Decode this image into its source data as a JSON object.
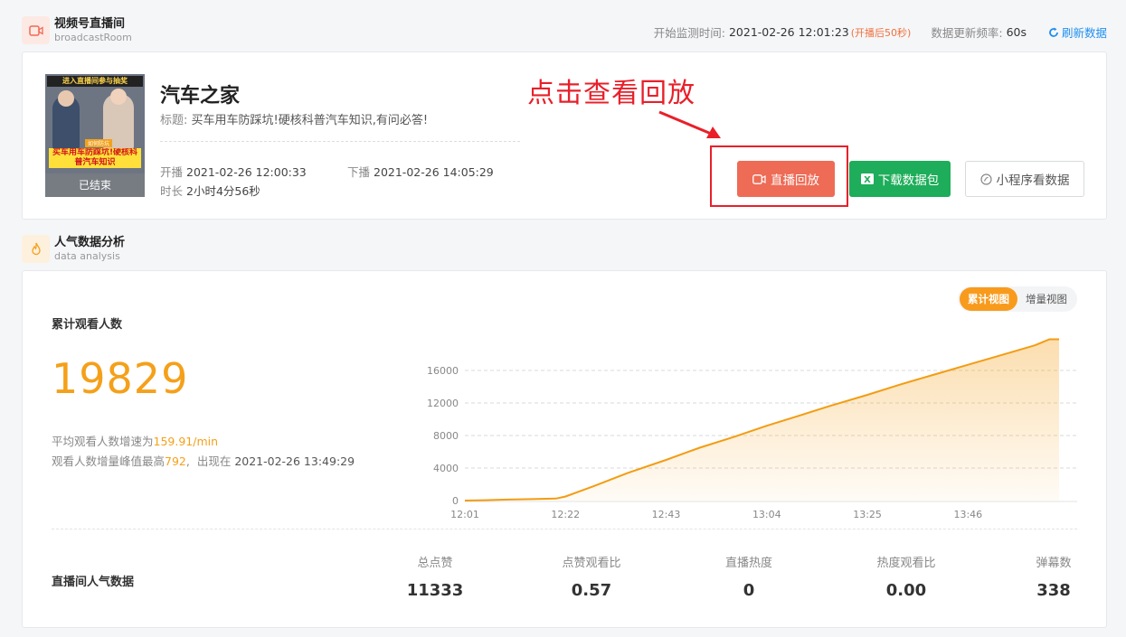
{
  "room_section": {
    "title": "视频号直播间",
    "subtitle": "broadcastRoom",
    "icon": "video-camera-icon"
  },
  "monitor": {
    "start_label": "开始监测时间:",
    "start_value": "2021-02-26 12:01:23",
    "start_note": "(开播后50秒)",
    "freq_label": "数据更新频率:",
    "freq_value": "60s",
    "refresh_label": "刷新数据"
  },
  "broadcast": {
    "cover_banner": "进入直播间参与抽奖",
    "cover_tag": "如何防坑",
    "cover_text": "买车用车防踩坑!硬核科普汽车知识",
    "cover_status": "已结束",
    "name": "汽车之家",
    "title_label": "标题:",
    "title_value": "买车用车防踩坑!硬核科普汽车知识,有问必答!",
    "start_label": "开播",
    "start_value": "2021-02-26 12:00:33",
    "end_label": "下播",
    "end_value": "2021-02-26 14:05:29",
    "duration_label": "时长",
    "duration_value": "2小时4分56秒",
    "annotation": "点击查看回放",
    "buttons": {
      "replay": "直播回放",
      "download": "下载数据包",
      "mini": "小程序看数据"
    }
  },
  "analysis_section": {
    "title": "人气数据分析",
    "subtitle": "data analysis",
    "icon": "flame-icon"
  },
  "view_toggle": {
    "cumulative": "累计视图",
    "incremental": "增量视图",
    "active": "cumulative"
  },
  "metric": {
    "label": "累计观看人数",
    "value": "19829",
    "avg_prefix": "平均观看人数增速为",
    "avg_value": "159.91/min",
    "peak_prefix": "观看人数增量峰值最高",
    "peak_value": "792",
    "peak_mid": ",",
    "peak_time_prefix": "出现在",
    "peak_time": "2021-02-26 13:49:29"
  },
  "chart_data": {
    "type": "area",
    "x": [
      "12:01",
      "12:05",
      "12:10",
      "12:15",
      "12:20",
      "12:22",
      "12:28",
      "12:35",
      "12:43",
      "12:50",
      "12:57",
      "13:04",
      "13:10",
      "13:17",
      "13:25",
      "13:32",
      "13:39",
      "13:46",
      "13:53",
      "14:00",
      "14:03",
      "14:05"
    ],
    "series": [
      {
        "values": [
          0,
          50,
          120,
          180,
          250,
          500,
          1800,
          3400,
          5000,
          6500,
          7800,
          9200,
          10300,
          11600,
          13000,
          14300,
          15500,
          16700,
          17900,
          19100,
          19829,
          19829
        ]
      }
    ],
    "x_ticks": [
      "12:01",
      "12:22",
      "12:43",
      "13:04",
      "13:25",
      "13:46"
    ],
    "y_ticks": [
      0,
      4000,
      8000,
      12000,
      16000
    ],
    "ylim": [
      0,
      20000
    ],
    "grid": true,
    "color": "#f39c12"
  },
  "popularity": {
    "label": "直播间人气数据",
    "columns": [
      {
        "header": "总点赞",
        "value": "11333"
      },
      {
        "header": "点赞观看比",
        "value": "0.57"
      },
      {
        "header": "直播热度",
        "value": "0"
      },
      {
        "header": "热度观看比",
        "value": "0.00"
      },
      {
        "header": "弹幕数",
        "value": "338"
      }
    ]
  }
}
